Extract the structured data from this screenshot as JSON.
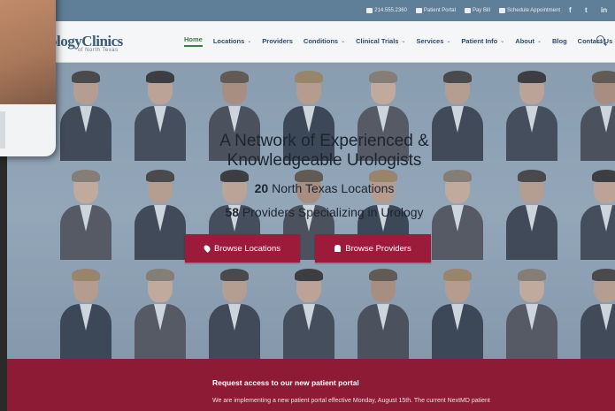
{
  "topbar": {
    "phone": "214.555.2360",
    "patient_portal": "Patient Portal",
    "pay_bill": "Pay Bill",
    "schedule": "Schedule Appointment",
    "social": [
      "f",
      "t",
      "in"
    ]
  },
  "header": {
    "logo_text": "ologyClinics",
    "logo_sub": "of North Texas"
  },
  "nav": {
    "items": [
      {
        "label": "Home",
        "active": true,
        "has_dropdown": false
      },
      {
        "label": "Locations",
        "active": false,
        "has_dropdown": true
      },
      {
        "label": "Providers",
        "active": false,
        "has_dropdown": false
      },
      {
        "label": "Conditions",
        "active": false,
        "has_dropdown": true
      },
      {
        "label": "Clinical Trials",
        "active": false,
        "has_dropdown": true
      },
      {
        "label": "Services",
        "active": false,
        "has_dropdown": true
      },
      {
        "label": "Patient Info",
        "active": false,
        "has_dropdown": true
      },
      {
        "label": "About",
        "active": false,
        "has_dropdown": true
      },
      {
        "label": "Blog",
        "active": false,
        "has_dropdown": false
      },
      {
        "label": "Contact Us",
        "active": false,
        "has_dropdown": false
      }
    ],
    "search_icon": "search-icon"
  },
  "hero": {
    "title_line1": "A Network of Experienced &",
    "title_line2": "Knowledgeable Urologists",
    "locations_count": "20",
    "locations_text": "North Texas Locations",
    "providers_count": "58",
    "providers_text": "Providers Specializing in Urology",
    "browse_locations": "Browse Locations",
    "browse_providers": "Browse Providers",
    "accent": "#9c1b3a"
  },
  "notice": {
    "title": "Request access to our new patient portal",
    "text": "We are implementing a new patient portal effective Monday, August 15th. The current NextMD patient"
  }
}
